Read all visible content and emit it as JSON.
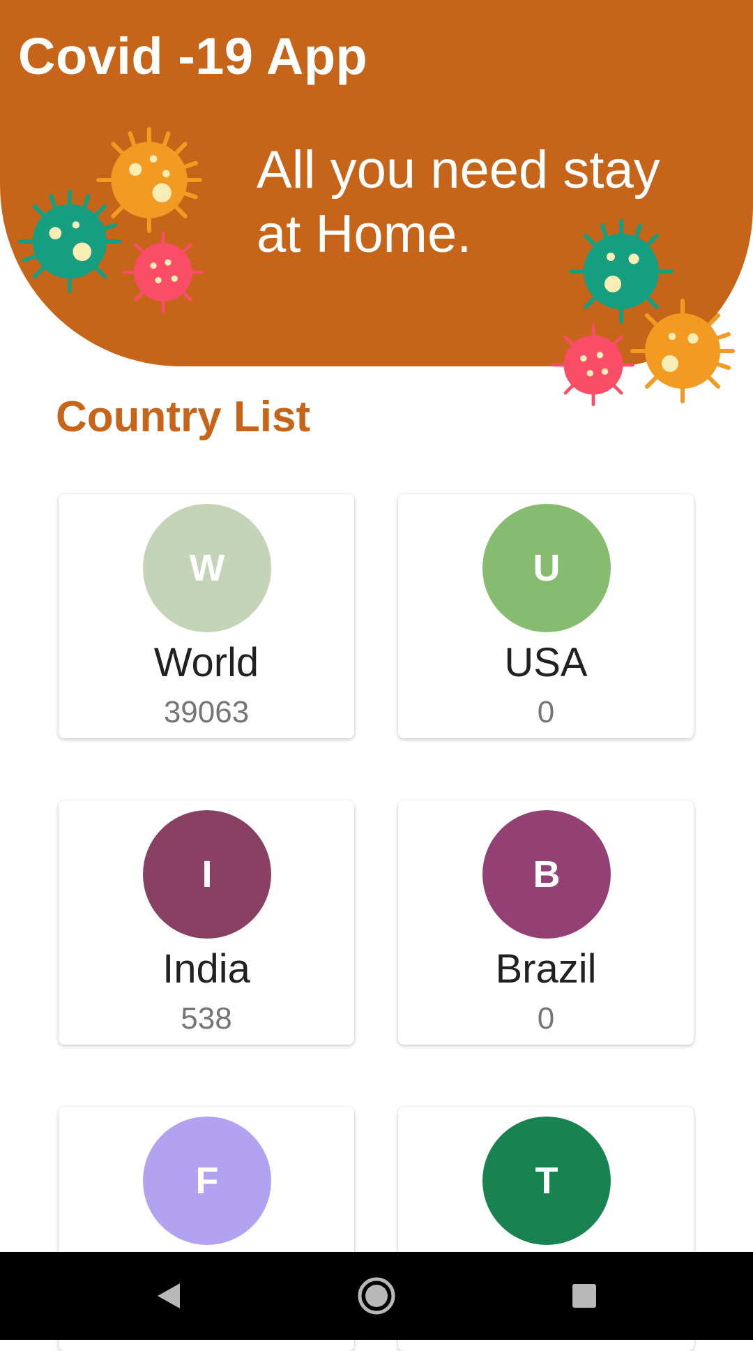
{
  "header": {
    "app_title": "Covid -19 App",
    "tagline": "All you need stay at Home."
  },
  "section_title": "Country List",
  "countries": [
    {
      "initial": "W",
      "name": "World",
      "count": "39063",
      "color": "#c5d4b6"
    },
    {
      "initial": "U",
      "name": "USA",
      "count": "0",
      "color": "#87bb6f"
    },
    {
      "initial": "I",
      "name": "India",
      "count": "538",
      "color": "#884163"
    },
    {
      "initial": "B",
      "name": "Brazil",
      "count": "0",
      "color": "#934174"
    },
    {
      "initial": "F",
      "name": "",
      "count": "",
      "color": "#b1a3f0"
    },
    {
      "initial": "T",
      "name": "",
      "count": "",
      "color": "#188350"
    }
  ],
  "colors": {
    "header_bg": "#c6651a",
    "accent": "#c6651a",
    "virus_green": "#169e80",
    "virus_orange": "#f29a21",
    "virus_pink": "#fa4d67",
    "virus_spots": "#f7edb5"
  },
  "navbar": {
    "back": "back-icon",
    "home": "home-icon",
    "recents": "recents-icon"
  }
}
